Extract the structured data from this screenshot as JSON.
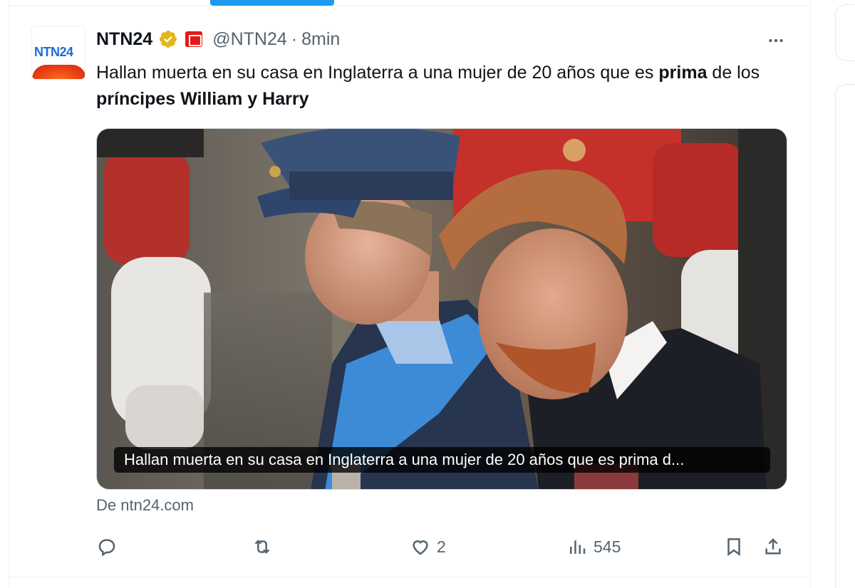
{
  "tweet": {
    "author_name": "NTN24",
    "handle": "@NTN24",
    "separator": "·",
    "time": "8min",
    "avatar_text": "NTN24",
    "text_parts": [
      "Hallan muerta en su casa en Inglaterra a una mujer de 20 años que es ",
      "prima",
      " de los ",
      "príncipes William y Harry"
    ],
    "media_caption": "Hallan muerta en su casa en Inglaterra a una mujer de 20 años que es prima d...",
    "source": "De ntn24.com"
  },
  "actions": {
    "reply_count": "",
    "retweet_count": "",
    "like_count": "2",
    "views_count": "545"
  },
  "icons": {
    "verified": "verified-badge-icon",
    "flag": "government-flag-icon",
    "more": "more-icon",
    "reply": "reply-icon",
    "retweet": "retweet-icon",
    "like": "heart-icon",
    "views": "views-icon",
    "bookmark": "bookmark-icon",
    "share": "share-icon"
  },
  "colors": {
    "accent": "#1d9bf0",
    "verified_gold": "#e2b719",
    "secondary_text": "#536471",
    "primary_text": "#0f1419"
  }
}
